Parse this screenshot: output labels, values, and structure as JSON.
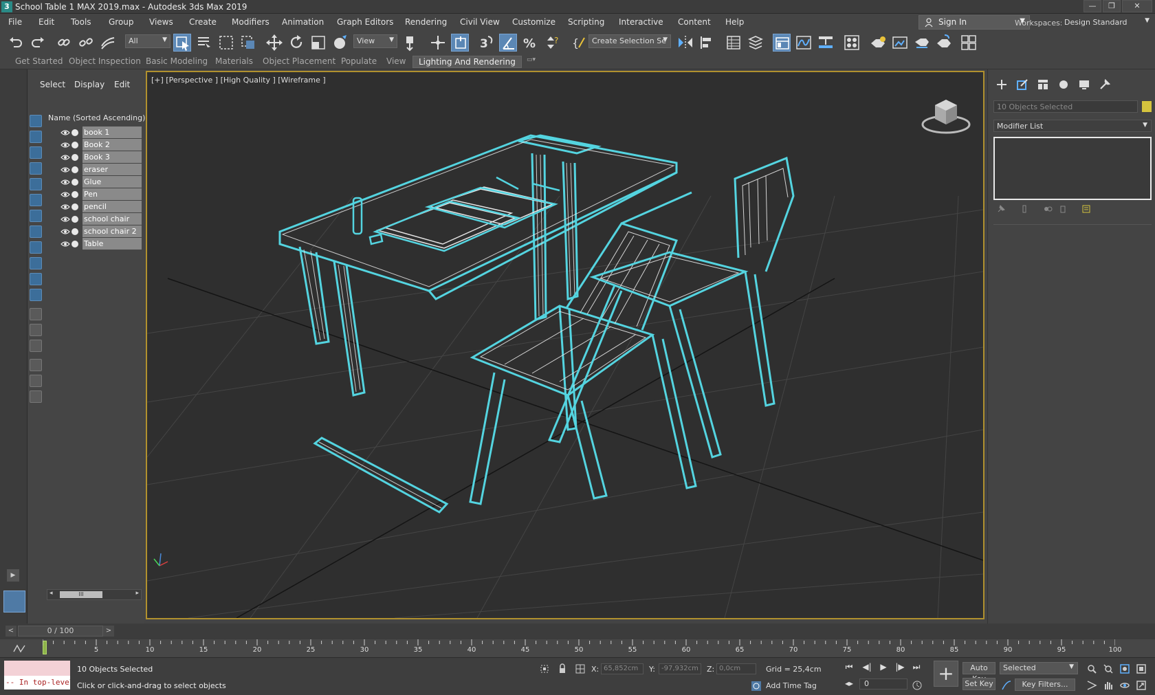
{
  "window": {
    "title": "School Table 1 MAX 2019.max - Autodesk 3ds Max 2019",
    "app_icon": "3",
    "controls": [
      "—",
      "❐",
      "✕"
    ]
  },
  "menu": {
    "items": [
      "File",
      "Edit",
      "Tools",
      "Group",
      "Views",
      "Create",
      "Modifiers",
      "Animation",
      "Graph Editors",
      "Rendering",
      "Civil View",
      "Customize",
      "Scripting",
      "Interactive",
      "Content",
      "Help"
    ],
    "sign_in": "Sign In",
    "workspaces_label": "Workspaces:",
    "workspace_value": "Design Standard"
  },
  "toolbar": {
    "filter_value": "All",
    "refcoord_value": "View",
    "selection_set_value": "Create Selection Se"
  },
  "ribbon": {
    "tabs": [
      "Get Started",
      "Object Inspection",
      "Basic Modeling",
      "Materials",
      "Object Placement",
      "Populate",
      "View",
      "Lighting And Rendering"
    ],
    "active_index": 7
  },
  "explorer": {
    "tabs": [
      "Select",
      "Display",
      "Edit"
    ],
    "header": "Name (Sorted Ascending)",
    "objects": [
      "book 1",
      "Book 2",
      "Book 3",
      "eraser",
      "Glue",
      "Pen",
      "pencil",
      "school chair",
      "school chair 2",
      "Table"
    ]
  },
  "viewport": {
    "label": "[+] [Perspective ] [High Quality ] [Wireframe ]"
  },
  "command_panel": {
    "selection_text": "10 Objects Selected",
    "selection_color": "#d5c43e",
    "modifier_list": "Modifier List"
  },
  "time_slider": {
    "value": "0 / 100",
    "prev": "<",
    "next": ">"
  },
  "trackbar": {
    "ticks": [
      "5",
      "10",
      "15",
      "20",
      "25",
      "30",
      "35",
      "40",
      "45",
      "50",
      "55",
      "60",
      "65",
      "70",
      "75",
      "80",
      "85",
      "90",
      "95",
      "100"
    ]
  },
  "status": {
    "maxscript_text": "-- In top-level",
    "selection": "10 Objects Selected",
    "prompt": "Click or click-and-drag to select objects",
    "x_label": "X:",
    "x_value": "65,852cm",
    "y_label": "Y:",
    "y_value": "-97,932cm",
    "z_label": "Z:",
    "z_value": "0,0cm",
    "grid": "Grid = 25,4cm",
    "add_time_tag": "Add Time Tag",
    "auto_key": "Auto Key",
    "set_key": "Set Key",
    "selected_value": "Selected",
    "key_filters": "Key Filters...",
    "frame_value": "0"
  },
  "colors": {
    "selection_wire": "#54d4e0",
    "viewport_border": "#b1912e",
    "active_tool": "#5b87b5"
  }
}
